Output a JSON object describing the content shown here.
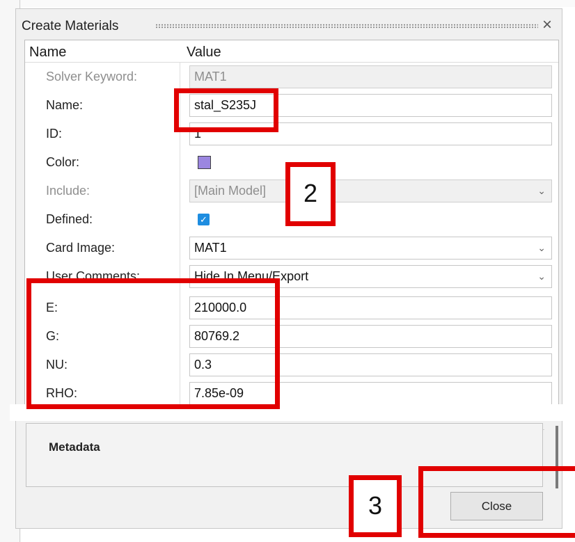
{
  "dialog": {
    "title": "Create Materials",
    "close_icon": "close-icon"
  },
  "grid": {
    "header_name": "Name",
    "header_value": "Value",
    "rows": [
      {
        "label": "Solver Keyword:",
        "value": "MAT1",
        "kind": "text",
        "disabled": true
      },
      {
        "label": "Name:",
        "value": "stal_S235J",
        "kind": "text",
        "disabled": false
      },
      {
        "label": "ID:",
        "value": "1",
        "kind": "text",
        "disabled": false
      },
      {
        "label": "Color:",
        "value": "#9b86e0",
        "kind": "color",
        "disabled": false
      },
      {
        "label": "Include:",
        "value": "[Main Model]",
        "kind": "select",
        "disabled": true
      },
      {
        "label": "Defined:",
        "value": "checked",
        "kind": "checkbox",
        "disabled": false
      },
      {
        "label": "Card Image:",
        "value": "MAT1",
        "kind": "select",
        "disabled": false
      },
      {
        "label": "User Comments:",
        "value": "Hide In Menu/Export",
        "kind": "select",
        "disabled": false
      },
      {
        "label": "E:",
        "value": "210000.0",
        "kind": "text",
        "disabled": false
      },
      {
        "label": "G:",
        "value": "80769.2",
        "kind": "text",
        "disabled": false
      },
      {
        "label": "NU:",
        "value": "0.3",
        "kind": "text",
        "disabled": false
      },
      {
        "label": "RHO:",
        "value": "7.85e-09",
        "kind": "text",
        "disabled": false
      }
    ]
  },
  "metadata": {
    "title": "Metadata"
  },
  "footer": {
    "close_label": "Close"
  },
  "annotations": {
    "num_2": "2",
    "num_3": "3",
    "color": "#e10000"
  }
}
